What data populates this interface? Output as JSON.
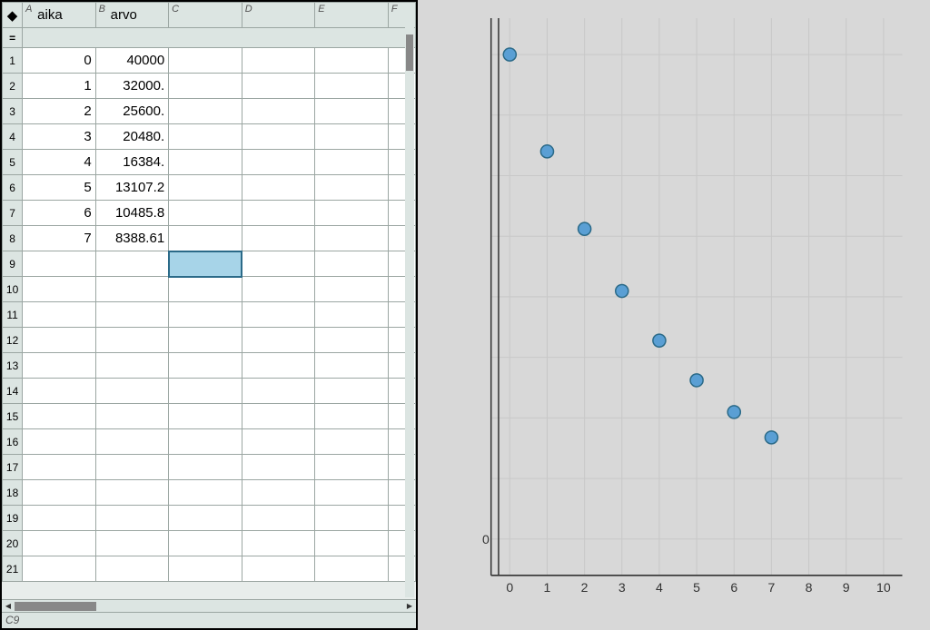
{
  "spreadsheet": {
    "columns": [
      {
        "letter": "A",
        "name": "aika"
      },
      {
        "letter": "B",
        "name": "arvo"
      },
      {
        "letter": "C",
        "name": ""
      },
      {
        "letter": "D",
        "name": ""
      },
      {
        "letter": "E",
        "name": ""
      },
      {
        "letter": "F",
        "name": ""
      }
    ],
    "formula_symbol": "=",
    "row_count": 21,
    "rows": [
      {
        "n": 1,
        "a": "0",
        "b": "40000"
      },
      {
        "n": 2,
        "a": "1",
        "b": "32000."
      },
      {
        "n": 3,
        "a": "2",
        "b": "25600."
      },
      {
        "n": 4,
        "a": "3",
        "b": "20480."
      },
      {
        "n": 5,
        "a": "4",
        "b": "16384."
      },
      {
        "n": 6,
        "a": "5",
        "b": "13107.2"
      },
      {
        "n": 7,
        "a": "6",
        "b": "10485.8"
      },
      {
        "n": 8,
        "a": "7",
        "b": "8388.61"
      }
    ],
    "selected_cell": "C9",
    "cellref": "C9"
  },
  "chart_data": {
    "type": "scatter",
    "x": [
      0,
      1,
      2,
      3,
      4,
      5,
      6,
      7
    ],
    "y": [
      40000,
      32000,
      25600,
      20480,
      16384,
      13107.2,
      10485.8,
      8388.61
    ],
    "x_ticks": [
      0,
      1,
      2,
      3,
      4,
      5,
      6,
      7,
      8,
      9,
      10
    ],
    "y_ticks": [
      0
    ],
    "xlim": [
      -0.5,
      10.5
    ],
    "ylim": [
      -3000,
      43000
    ]
  }
}
